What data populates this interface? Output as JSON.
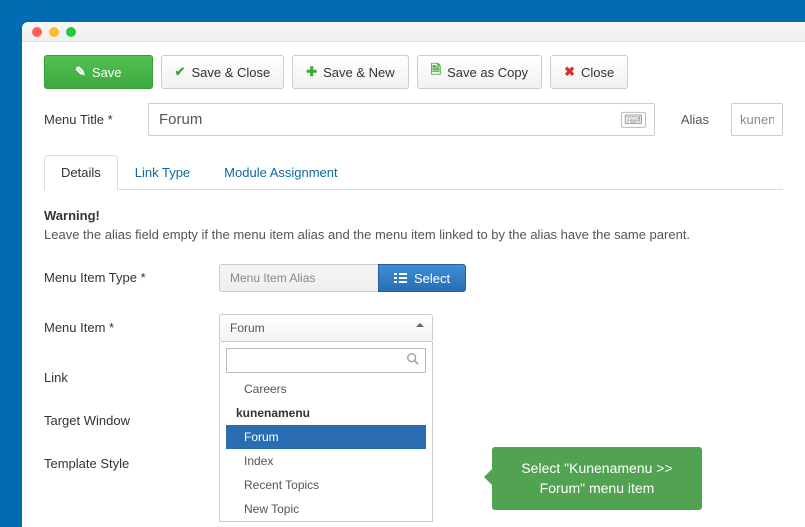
{
  "toolbar": {
    "save": "Save",
    "save_close": "Save & Close",
    "save_new": "Save & New",
    "save_copy": "Save as Copy",
    "close": "Close"
  },
  "title_row": {
    "menu_title_label": "Menu Title *",
    "menu_title_value": "Forum",
    "alias_label": "Alias",
    "alias_value": "kunen"
  },
  "tabs": [
    "Details",
    "Link Type",
    "Module Assignment"
  ],
  "warning": {
    "title": "Warning!",
    "text": "Leave the alias field empty if the menu item alias and the menu item linked to by the alias have the same parent."
  },
  "fields": {
    "menu_item_type": {
      "label": "Menu Item Type *",
      "value": "Menu Item Alias",
      "button": "Select"
    },
    "menu_item": {
      "label": "Menu Item *",
      "selected": "Forum"
    },
    "link": {
      "label": "Link"
    },
    "target_window": {
      "label": "Target Window"
    },
    "template_style": {
      "label": "Template Style"
    }
  },
  "dropdown": {
    "options": [
      {
        "label": "Careers",
        "type": "child"
      },
      {
        "label": "kunenamenu",
        "type": "group"
      },
      {
        "label": "Forum",
        "type": "child",
        "highlight": true
      },
      {
        "label": "Index",
        "type": "child"
      },
      {
        "label": "Recent Topics",
        "type": "child"
      },
      {
        "label": "New Topic",
        "type": "child"
      }
    ]
  },
  "tooltip": "Select \"Kunenamenu >> Forum\" menu item"
}
